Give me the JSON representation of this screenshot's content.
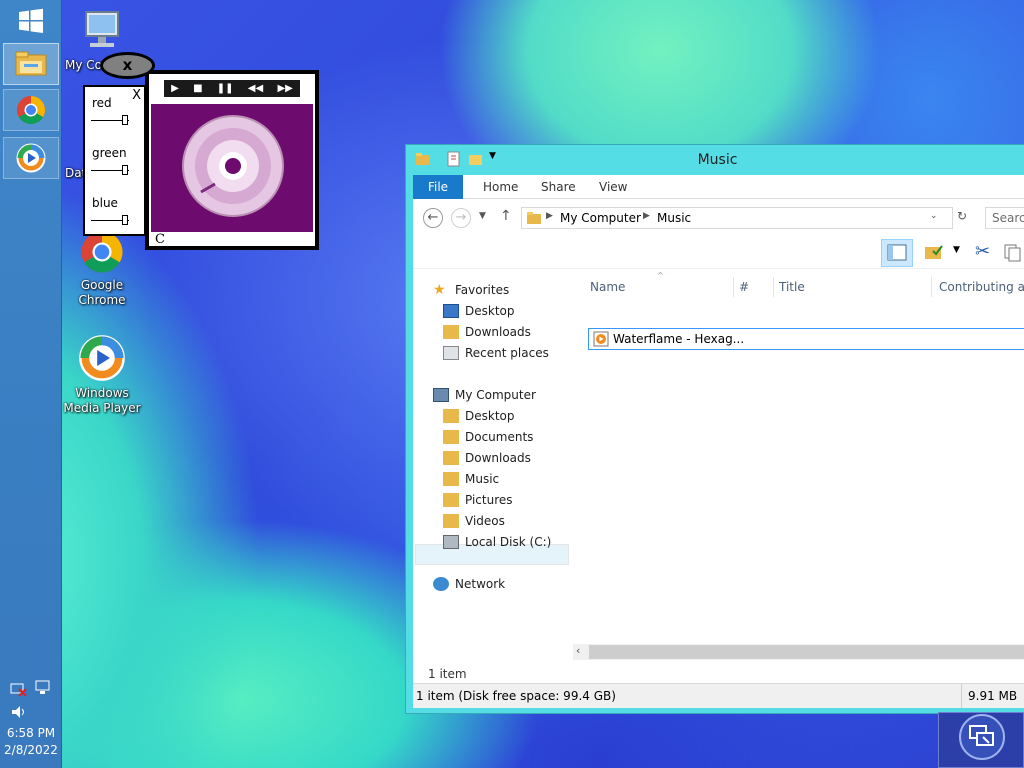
{
  "taskbar": {
    "time": "6:58 PM",
    "date": "2/8/2022",
    "buttons": [
      {
        "icon": "windows-start-icon"
      },
      {
        "icon": "file-explorer-icon"
      },
      {
        "icon": "chrome-icon"
      },
      {
        "icon": "media-player-icon"
      }
    ]
  },
  "desktop": {
    "icons": [
      {
        "label": "My Co",
        "icon": "my-computer-icon"
      },
      {
        "label": "Dat",
        "icon": "data-folder-icon"
      },
      {
        "label": "Google Chrome",
        "icon": "chrome-icon"
      },
      {
        "label": "Windows Media Player",
        "icon": "media-player-icon"
      }
    ]
  },
  "gadget": {
    "close_label": "x",
    "status_text": "C",
    "rgb_close": "X",
    "sliders": [
      {
        "label": "red",
        "value": 0.85
      },
      {
        "label": "green",
        "value": 0.85
      },
      {
        "label": "blue",
        "value": 0.85
      }
    ],
    "art_color": "#6e0b6e"
  },
  "explorer": {
    "title": "Music",
    "ribbon_tabs": [
      "File",
      "Home",
      "Share",
      "View"
    ],
    "breadcrumb": [
      "My Computer",
      "Music"
    ],
    "search_placeholder": "Search",
    "nav": {
      "favorites_label": "Favorites",
      "favorites": [
        "Desktop",
        "Downloads",
        "Recent places"
      ],
      "computer_label": "My Computer",
      "computer": [
        "Desktop",
        "Documents",
        "Downloads",
        "Music",
        "Pictures",
        "Videos",
        "Local Disk (C:)"
      ],
      "network_label": "Network",
      "selected": "Music"
    },
    "columns": [
      "Name",
      "#",
      "Title",
      "Contributing art"
    ],
    "files": [
      {
        "name": "Waterflame - Hexag..."
      }
    ],
    "item_count": "1 item",
    "status_left": "1 item (Disk free space: 99.4 GB)",
    "status_right": "9.91 MB"
  },
  "colors": {
    "accent": "#1979ca",
    "window_frame": "#55dde6",
    "selection": "#3399ff"
  }
}
